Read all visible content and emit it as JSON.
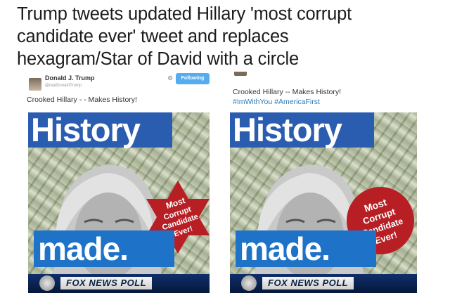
{
  "headline": {
    "line1": "Trump tweets updated Hillary 'most corrupt",
    "line2": "candidate ever' tweet and replaces",
    "line3": "hexagram/Star of David with a circle"
  },
  "left_tweet": {
    "author_name": "Donald J. Trump",
    "author_handle": "@realDonaldTrump",
    "follow_label": "Following",
    "text": "Crooked Hillary - - Makes History!",
    "cover": {
      "title": "History",
      "badge_shape": "star-of-david",
      "badge_color": "#b81f24",
      "badge_lines": [
        "Most",
        "Corrupt",
        "Candidate",
        "Ever!"
      ],
      "made": "made.",
      "poll_label": "FOX NEWS POLL"
    }
  },
  "right_tweet": {
    "text": "Crooked Hillary -- Makes History!",
    "hashtags": "#ImWithYou #AmericaFirst",
    "cover": {
      "title": "History",
      "badge_shape": "circle",
      "badge_color": "#b81f24",
      "badge_lines": [
        "Most",
        "Corrupt",
        "Candidate",
        "Ever!"
      ],
      "made": "made.",
      "poll_label": "FOX NEWS POLL"
    }
  },
  "colors": {
    "history_band": "#2a5db0",
    "made_band": "#1e73c8",
    "twitter_blue": "#55acee",
    "hashtag": "#2b7bb9"
  }
}
